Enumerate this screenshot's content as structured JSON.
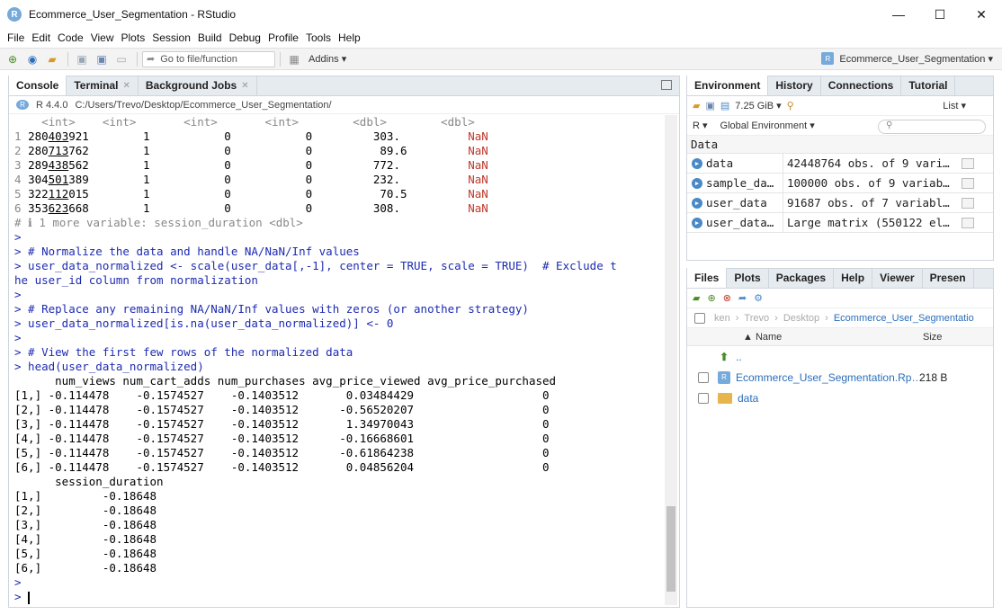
{
  "window": {
    "title": "Ecommerce_User_Segmentation - RStudio",
    "logo": "R",
    "minimize": "—",
    "maximize": "☐",
    "close": "✕"
  },
  "menu": [
    "File",
    "Edit",
    "Code",
    "View",
    "Plots",
    "Session",
    "Build",
    "Debug",
    "Profile",
    "Tools",
    "Help"
  ],
  "toolbar": {
    "goto_placeholder": "Go to file/function",
    "addins_label": "Addins ▾",
    "project_name": "Ecommerce_User_Segmentation ▾"
  },
  "console": {
    "tabs": [
      "Console",
      "Terminal",
      "Background Jobs"
    ],
    "r_version": "R 4.4.0",
    "path": "C:/Users/Trevo/Desktop/Ecommerce_User_Segmentation/",
    "type_header": "    <int>    <int>       <int>       <int>        <dbl>        <dbl>",
    "rows": [
      {
        "idx": "1",
        "pre": "280",
        "mid": "403",
        "post": "921",
        "rest": "        1           0           0         303.          ",
        "nan": "NaN"
      },
      {
        "idx": "2",
        "pre": "280",
        "mid": "713",
        "post": "762",
        "rest": "        1           0           0          89.6         ",
        "nan": "NaN"
      },
      {
        "idx": "3",
        "pre": "289",
        "mid": "438",
        "post": "562",
        "rest": "        1           0           0         772.          ",
        "nan": "NaN"
      },
      {
        "idx": "4",
        "pre": "304",
        "mid": "501",
        "post": "389",
        "rest": "        1           0           0         232.          ",
        "nan": "NaN"
      },
      {
        "idx": "5",
        "pre": "322",
        "mid": "112",
        "post": "015",
        "rest": "        1           0           0          70.5         ",
        "nan": "NaN"
      },
      {
        "idx": "6",
        "pre": "353",
        "mid": "623",
        "post": "668",
        "rest": "        1           0           0         308.          ",
        "nan": "NaN"
      }
    ],
    "more_var": "# ℹ 1 more variable: session_duration <dbl>",
    "lines_after": [
      {
        "text": ">",
        "cls": "cmd"
      },
      {
        "text": "> # Normalize the data and handle NA/NaN/Inf values",
        "cls": "cmd"
      },
      {
        "text": "> user_data_normalized <- scale(user_data[,-1], center = TRUE, scale = TRUE)  # Exclude t",
        "cls": "cmd"
      },
      {
        "text": "he user_id column from normalization",
        "cls": "cmd"
      },
      {
        "text": ">",
        "cls": "cmd"
      },
      {
        "text": "> # Replace any remaining NA/NaN/Inf values with zeros (or another strategy)",
        "cls": "cmd"
      },
      {
        "text": "> user_data_normalized[is.na(user_data_normalized)] <- 0",
        "cls": "cmd"
      },
      {
        "text": ">",
        "cls": "cmd"
      },
      {
        "text": "> # View the first few rows of the normalized data",
        "cls": "cmd"
      },
      {
        "text": "> head(user_data_normalized)",
        "cls": "cmd"
      },
      {
        "text": "      num_views num_cart_adds num_purchases avg_price_viewed avg_price_purchased",
        "cls": ""
      },
      {
        "text": "[1,] -0.114478    -0.1574527    -0.1403512       0.03484429                   0",
        "cls": ""
      },
      {
        "text": "[2,] -0.114478    -0.1574527    -0.1403512      -0.56520207                   0",
        "cls": ""
      },
      {
        "text": "[3,] -0.114478    -0.1574527    -0.1403512       1.34970043                   0",
        "cls": ""
      },
      {
        "text": "[4,] -0.114478    -0.1574527    -0.1403512      -0.16668601                   0",
        "cls": ""
      },
      {
        "text": "[5,] -0.114478    -0.1574527    -0.1403512      -0.61864238                   0",
        "cls": ""
      },
      {
        "text": "[6,] -0.114478    -0.1574527    -0.1403512       0.04856204                   0",
        "cls": ""
      },
      {
        "text": "      session_duration",
        "cls": ""
      },
      {
        "text": "[1,]         -0.18648",
        "cls": ""
      },
      {
        "text": "[2,]         -0.18648",
        "cls": ""
      },
      {
        "text": "[3,]         -0.18648",
        "cls": ""
      },
      {
        "text": "[4,]         -0.18648",
        "cls": ""
      },
      {
        "text": "[5,]         -0.18648",
        "cls": ""
      },
      {
        "text": "[6,]         -0.18648",
        "cls": ""
      },
      {
        "text": ">",
        "cls": "cmd"
      }
    ],
    "prompt": "> "
  },
  "environment": {
    "tabs": [
      "Environment",
      "History",
      "Connections",
      "Tutorial"
    ],
    "memory": "7.25 GiB ▾",
    "list_view": "List ▾",
    "lang": "R ▾",
    "scope": "Global Environment ▾",
    "section": "Data",
    "rows": [
      {
        "name": "data",
        "value": "42448764 obs. of 9 vari…"
      },
      {
        "name": "sample_da…",
        "value": "100000 obs. of 9 variab…"
      },
      {
        "name": "user_data",
        "value": "91687 obs. of 7 variabl…"
      },
      {
        "name": "user_data…",
        "value": "Large matrix (550122 el…"
      }
    ]
  },
  "files": {
    "tabs": [
      "Files",
      "Plots",
      "Packages",
      "Help",
      "Viewer",
      "Presen"
    ],
    "crumbs": [
      "ken",
      "Trevo",
      "Desktop"
    ],
    "current": "Ecommerce_User_Segmentatio",
    "col_name": "▲ Name",
    "col_size": "Size",
    "up": "..",
    "items": [
      {
        "name": "Ecommerce_User_Segmentation.Rp…",
        "size": "218 B",
        "type": "rproj"
      },
      {
        "name": "data",
        "size": "",
        "type": "folder"
      }
    ]
  },
  "colors": {
    "accent": "#75aadb",
    "command": "#1d2bb1",
    "nan": "#c0392b",
    "link": "#2a6ebb"
  }
}
